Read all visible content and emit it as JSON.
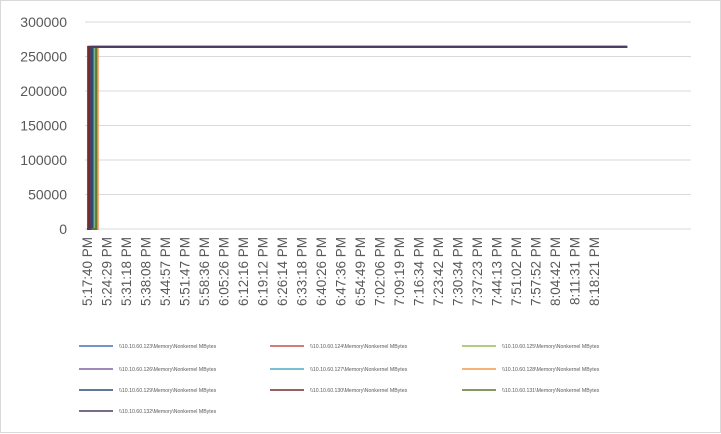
{
  "chart_data": {
    "type": "line",
    "title": "",
    "xlabel": "",
    "ylabel": "",
    "ylim": [
      0,
      300000
    ],
    "y_ticks": [
      "300000",
      "250000",
      "200000",
      "150000",
      "100000",
      "50000",
      "0"
    ],
    "y_tick_values": [
      300000,
      250000,
      200000,
      150000,
      100000,
      50000,
      0
    ],
    "categories": [
      "5:17:40 PM",
      "5:24:29 PM",
      "5:31:18 PM",
      "5:38:08 PM",
      "5:44:57 PM",
      "5:51:47 PM",
      "5:58:36 PM",
      "6:05:26 PM",
      "6:12:16 PM",
      "6:19:12 PM",
      "6:26:14 PM",
      "6:33:18 PM",
      "6:40:26 PM",
      "6:47:36 PM",
      "6:54:49 PM",
      "7:02:06 PM",
      "7:09:19 PM",
      "7:16:34 PM",
      "7:23:42 PM",
      "7:30:34 PM",
      "7:37:23 PM",
      "7:44:13 PM",
      "7:51:02 PM",
      "7:57:52 PM",
      "8:04:42 PM",
      "8:11:31 PM",
      "8:18:21 PM"
    ],
    "x_span": 27.7,
    "level": 264000,
    "gridlines": true,
    "legend_position": "bottom",
    "series": [
      {
        "name": "\\\\10.10.60.123\\Memory\\Nonkernel MBytes",
        "color": "#4472c4",
        "rise_x": 0.05
      },
      {
        "name": "\\\\10.10.60.124\\Memory\\Nonkernel MBytes",
        "color": "#c0504d",
        "rise_x": 0.12
      },
      {
        "name": "\\\\10.10.60.125\\Memory\\Nonkernel MBytes",
        "color": "#9bbb59",
        "rise_x": 0.4
      },
      {
        "name": "\\\\10.10.60.126\\Memory\\Nonkernel MBytes",
        "color": "#8064a2",
        "rise_x": 0.22
      },
      {
        "name": "\\\\10.10.60.127\\Memory\\Nonkernel MBytes",
        "color": "#4bacc6",
        "rise_x": 0.33
      },
      {
        "name": "\\\\10.10.60.128\\Memory\\Nonkernel MBytes",
        "color": "#f79646",
        "rise_x": 0.55
      },
      {
        "name": "\\\\10.10.60.129\\Memory\\Nonkernel MBytes",
        "color": "#2c4d75",
        "rise_x": 0.28
      },
      {
        "name": "\\\\10.10.60.130\\Memory\\Nonkernel MBytes",
        "color": "#772c2a",
        "rise_x": 0.08
      },
      {
        "name": "\\\\10.10.60.131\\Memory\\Nonkernel MBytes",
        "color": "#5f7530",
        "rise_x": 0.47
      },
      {
        "name": "\\\\10.10.60.132\\Memory\\Nonkernel MBytes",
        "color": "#4d3b62",
        "rise_x": 0.18
      }
    ]
  }
}
